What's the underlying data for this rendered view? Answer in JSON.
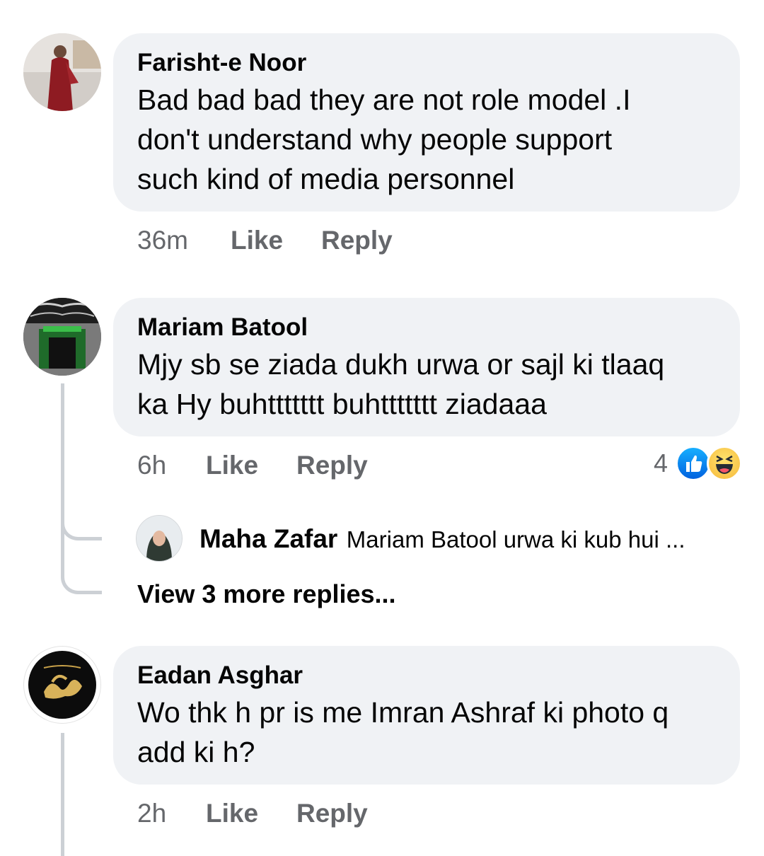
{
  "comments": [
    {
      "author": "Farisht-e Noor",
      "lines": [
        "Bad bad bad they are not role model .I",
        "don't understand why people support",
        "such kind of media personnel"
      ],
      "time": "36m",
      "like_label": "Like",
      "reply_label": "Reply"
    },
    {
      "author": "Mariam Batool",
      "lines": [
        "Mjy sb se ziada dukh urwa or sajl ki tlaaq",
        "ka Hy buhttttttt buhttttttt ziadaaa"
      ],
      "time": "6h",
      "like_label": "Like",
      "reply_label": "Reply",
      "reaction_count": "4",
      "reactions": [
        "like-icon",
        "haha-icon"
      ],
      "reply_preview": {
        "author": "Maha Zafar",
        "text": "Mariam Batool urwa ki kub hui ..."
      },
      "more_replies_label": "View 3 more replies..."
    },
    {
      "author": "Eadan Asghar",
      "lines": [
        "Wo thk h pr is me Imran Ashraf ki photo q",
        "add ki h?"
      ],
      "time": "2h",
      "like_label": "Like",
      "reply_label": "Reply"
    }
  ],
  "colors": {
    "bubble": "#f0f2f5",
    "text": "#050505",
    "meta": "#65676b",
    "thread_line": "#ccd0d5",
    "like_blue": "#1877f2"
  }
}
